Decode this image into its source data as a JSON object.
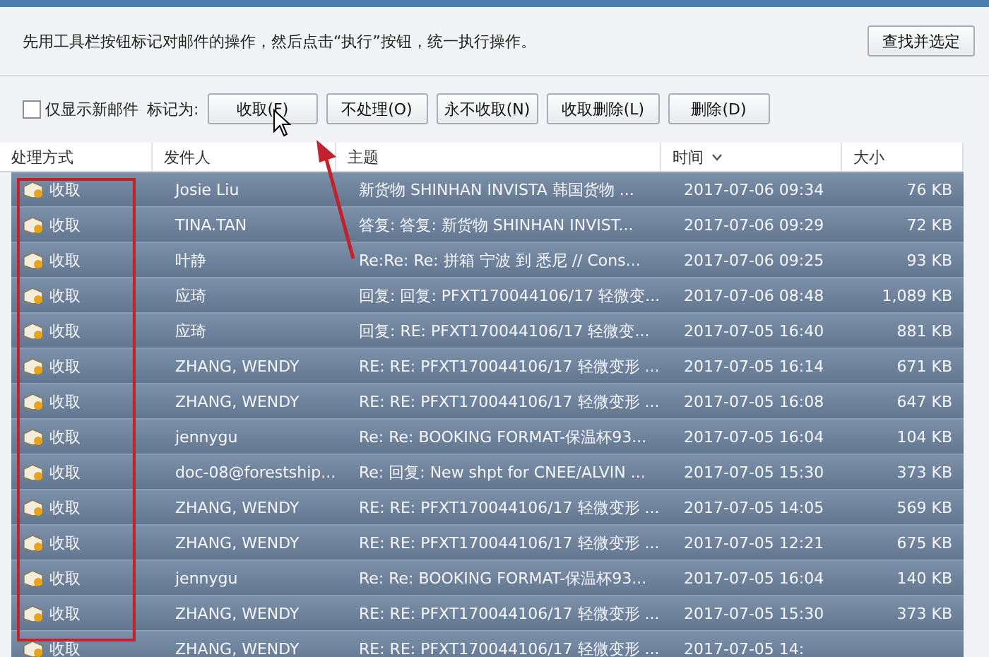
{
  "hint": "先用工具栏按钮标记对邮件的操作，然后点击“执行”按钮，统一执行操作。",
  "find_button": "查找并选定",
  "new_only": {
    "label": "仅显示新邮件",
    "checked": false
  },
  "mark_label": "标记为:",
  "mark_buttons": [
    "收取(F)",
    "不处理(O)",
    "永不收取(N)",
    "收取删除(L)",
    "删除(D)"
  ],
  "columns": [
    {
      "label": "处理方式"
    },
    {
      "label": "发件人"
    },
    {
      "label": "主题"
    },
    {
      "label": "时间",
      "sorted": true
    },
    {
      "label": "大小"
    }
  ],
  "rows": [
    {
      "action": "收取",
      "from": "Josie Liu",
      "subject": "新货物  SHINHAN INVISTA  韩国货物 ...",
      "time": "2017-07-06 09:34",
      "size": "76 KB"
    },
    {
      "action": "收取",
      "from": "TINA.TAN",
      "subject": "答复: 答复: 新货物  SHINHAN INVIST...",
      "time": "2017-07-06 09:29",
      "size": "72 KB"
    },
    {
      "action": "收取",
      "from": "叶静",
      "subject": "Re:Re: Re: 拼箱  宁波 到 悉尼  // Cons...",
      "time": "2017-07-06 09:25",
      "size": "93 KB"
    },
    {
      "action": "收取",
      "from": "应琦",
      "subject": "回复: 回复: PFXT170044106/17 轻微变...",
      "time": "2017-07-06 08:48",
      "size": "1,089 KB"
    },
    {
      "action": "收取",
      "from": "应琦",
      "subject": "回复: RE: PFXT170044106/17 轻微变...",
      "time": "2017-07-05 16:40",
      "size": "881 KB"
    },
    {
      "action": "收取",
      "from": "ZHANG, WENDY",
      "subject": "RE: RE: PFXT170044106/17 轻微变形 ...",
      "time": "2017-07-05 16:14",
      "size": "671 KB"
    },
    {
      "action": "收取",
      "from": "ZHANG, WENDY",
      "subject": "RE: RE: PFXT170044106/17 轻微变形 ...",
      "time": "2017-07-05 16:08",
      "size": "647 KB"
    },
    {
      "action": "收取",
      "from": "jennygu",
      "subject": "Re: Re: BOOKING FORMAT-保温杯93...",
      "time": "2017-07-05 16:04",
      "size": "104 KB"
    },
    {
      "action": "收取",
      "from": "doc-08@forestship...",
      "subject": "Re: 回复: New shpt for CNEE/ALVIN ...",
      "time": "2017-07-05 15:30",
      "size": "373 KB"
    },
    {
      "action": "收取",
      "from": "ZHANG, WENDY",
      "subject": "RE: RE: PFXT170044106/17 轻微变形 ...",
      "time": "2017-07-05 14:05",
      "size": "569 KB"
    },
    {
      "action": "收取",
      "from": "ZHANG, WENDY",
      "subject": "RE: RE: PFXT170044106/17 轻微变形 ...",
      "time": "2017-07-05 12:21",
      "size": "675 KB"
    },
    {
      "action": "收取",
      "from": "jennygu",
      "subject": "Re: Re: BOOKING FORMAT-保温杯93...",
      "time": "2017-07-05 16:04",
      "size": "140 KB"
    },
    {
      "action": "收取",
      "from": "ZHANG, WENDY",
      "subject": "RE: RE: PFXT170044106/17 轻微变形 ...",
      "time": "2017-07-05 15:30",
      "size": "373 KB"
    },
    {
      "action": "收取",
      "from": "ZHANG, WENDY",
      "subject": "RE: RE: PFXT170044106/17 轻微变形 ...",
      "time": "2017-07-05 14:",
      "size": ""
    }
  ]
}
